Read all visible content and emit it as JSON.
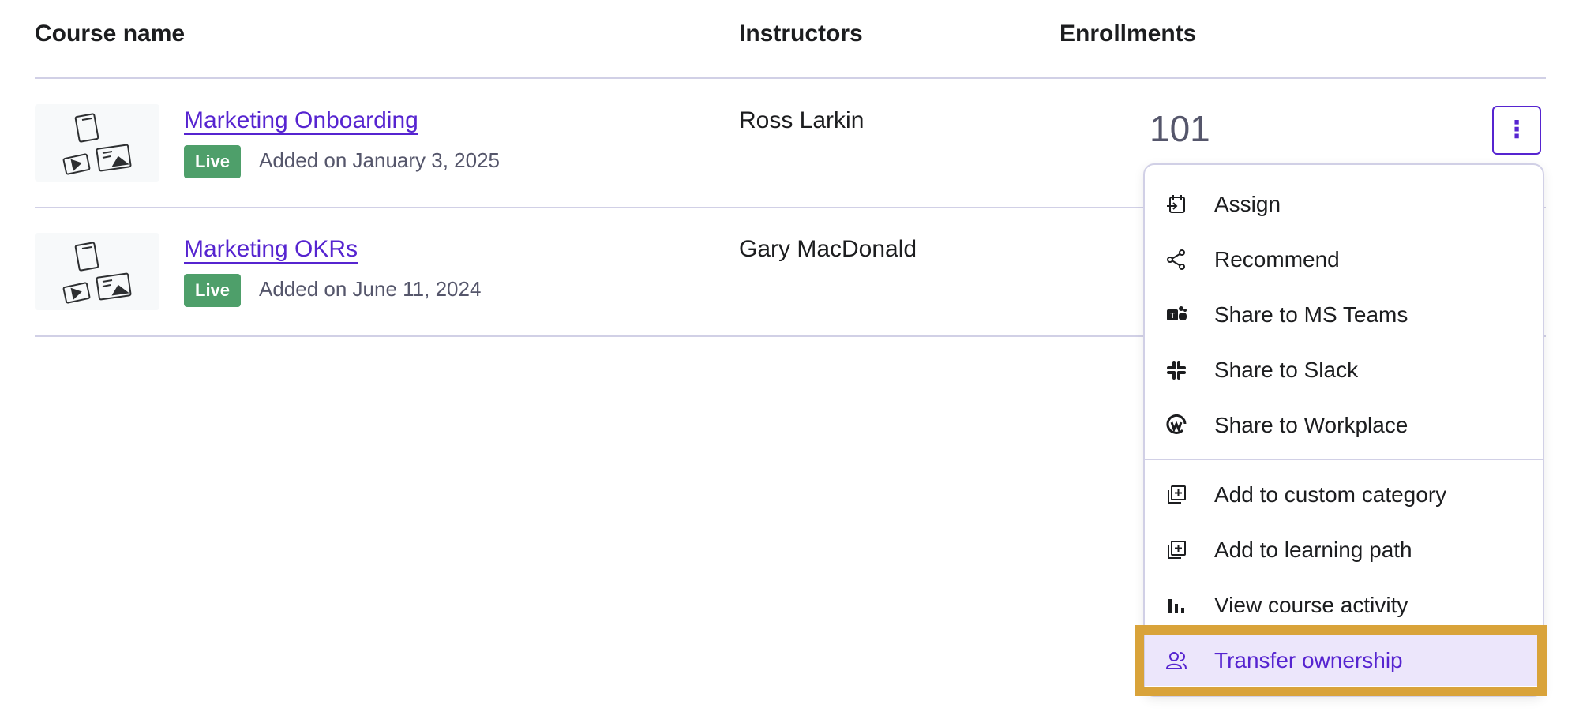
{
  "table": {
    "headers": {
      "course_name": "Course name",
      "instructors": "Instructors",
      "enrollments": "Enrollments"
    },
    "rows": [
      {
        "title": "Marketing Onboarding",
        "status": "Live",
        "added": "Added on January 3, 2025",
        "instructor": "Ross Larkin",
        "enrollments": "101"
      },
      {
        "title": "Marketing OKRs",
        "status": "Live",
        "added": "Added on June 11, 2024",
        "instructor": "Gary MacDonald",
        "enrollments": ""
      }
    ]
  },
  "kebab_button": {
    "icon": "more-vertical-icon",
    "glyph": "⋮"
  },
  "menu": {
    "items": [
      {
        "label": "Assign",
        "icon": "calendar-assign-icon"
      },
      {
        "label": "Recommend",
        "icon": "share-nodes-icon"
      },
      {
        "label": "Share to MS Teams",
        "icon": "ms-teams-icon"
      },
      {
        "label": "Share to Slack",
        "icon": "slack-icon"
      },
      {
        "label": "Share to Workplace",
        "icon": "workplace-icon"
      },
      {
        "label": "Add to custom category",
        "icon": "add-to-stack-icon"
      },
      {
        "label": "Add to learning path",
        "icon": "add-to-stack-icon"
      },
      {
        "label": "View course activity",
        "icon": "bar-chart-icon"
      },
      {
        "label": "Transfer ownership",
        "icon": "users-transfer-icon"
      }
    ],
    "highlighted_item": "Transfer ownership"
  },
  "colors": {
    "link": "#5624d0",
    "live_badge": "#4e9f6a",
    "highlight_frame": "#d9a33a",
    "highlight_bg": "#ece6fb",
    "divider": "#d1d0e6"
  }
}
